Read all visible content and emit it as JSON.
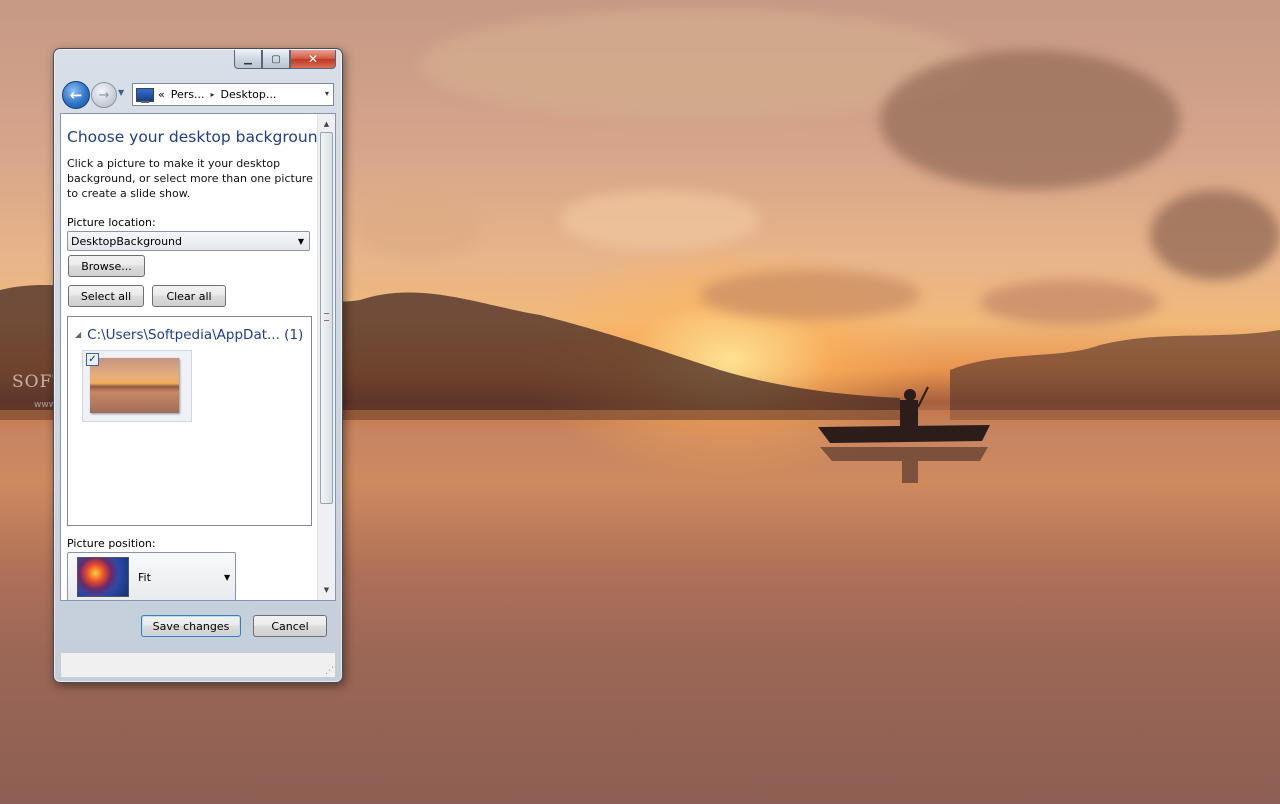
{
  "wallpaper": {
    "watermark": "SOFTPEDIA",
    "watermark_url": "www.softpedia.com"
  },
  "window": {
    "caption_buttons": {
      "minimize_icon": "minimize-icon",
      "maximize_icon": "maximize-icon",
      "close_icon": "close-icon"
    },
    "nav": {
      "back_icon": "back-arrow-icon",
      "forward_icon": "forward-arrow-icon",
      "history_icon": "recent-pages-dropdown-icon"
    },
    "address": {
      "overflow": "«",
      "segments": [
        "Pers...",
        "Desktop..."
      ],
      "separator": "▸",
      "dropdown": "▾"
    },
    "header": {
      "title": "Choose your desktop background",
      "description": "Click a picture to make it your desktop background, or select more than one picture to create a slide show."
    },
    "picture_location": {
      "label": "Picture location:",
      "value": "DesktopBackground",
      "browse_label": "Browse..."
    },
    "select_all_label": "Select all",
    "clear_all_label": "Clear all",
    "gallery": {
      "group_title": "C:\\Users\\Softpedia\\AppDat... (1)",
      "items": [
        {
          "checked": true,
          "check_glyph": "✓"
        }
      ]
    },
    "picture_position": {
      "label": "Picture position:",
      "value": "Fit"
    },
    "save_label": "Save changes",
    "cancel_label": "Cancel"
  }
}
